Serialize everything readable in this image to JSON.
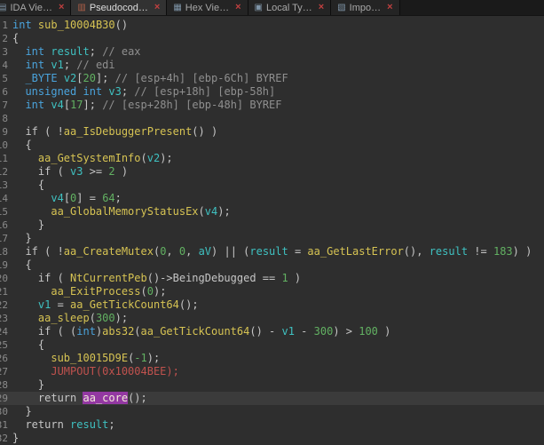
{
  "ui": {
    "close_glyph": "×"
  },
  "colors": {
    "background": "#2e2e2e",
    "type_keyword": "#4aa3dc",
    "identifier": "#3fc1c1",
    "function_name": "#d6c353",
    "number": "#62b162",
    "comment": "#8f8f8f",
    "macro": "#c0524e",
    "highlight_background": "#9338a2",
    "current_line_background": "#3b3b3b",
    "tab_close": "#c14040"
  },
  "tabs": [
    {
      "id": "ida-view",
      "label": "IDA Vie…",
      "icon": "ida-view-icon",
      "glyph": "▤",
      "active": false
    },
    {
      "id": "pseudocode",
      "label": "Pseudocod…",
      "icon": "pseudocode-icon",
      "glyph": "▥",
      "active": true
    },
    {
      "id": "hex-view",
      "label": "Hex Vie…",
      "icon": "hex-view-icon",
      "glyph": "▦",
      "active": false
    },
    {
      "id": "local-types",
      "label": "Local Ty…",
      "icon": "local-types-icon",
      "glyph": "▣",
      "active": false
    },
    {
      "id": "imports",
      "label": "Impo…",
      "icon": "imports-icon",
      "glyph": "▧",
      "active": false
    }
  ],
  "code": {
    "lines": [
      {
        "n": 1,
        "tokens": [
          {
            "c": "type",
            "t": "int"
          },
          {
            "c": "plain",
            "t": " "
          },
          {
            "c": "func",
            "t": "sub_10004B30"
          },
          {
            "c": "plain",
            "t": "()"
          }
        ]
      },
      {
        "n": 2,
        "tokens": [
          {
            "c": "plain",
            "t": "{"
          }
        ]
      },
      {
        "n": 3,
        "tokens": [
          {
            "c": "plain",
            "t": "  "
          },
          {
            "c": "type",
            "t": "int"
          },
          {
            "c": "plain",
            "t": " "
          },
          {
            "c": "var",
            "t": "result"
          },
          {
            "c": "plain",
            "t": "; "
          },
          {
            "c": "comment",
            "t": "// eax"
          }
        ]
      },
      {
        "n": 4,
        "tokens": [
          {
            "c": "plain",
            "t": "  "
          },
          {
            "c": "type",
            "t": "int"
          },
          {
            "c": "plain",
            "t": " "
          },
          {
            "c": "var",
            "t": "v1"
          },
          {
            "c": "plain",
            "t": "; "
          },
          {
            "c": "comment",
            "t": "// edi"
          }
        ]
      },
      {
        "n": 5,
        "tokens": [
          {
            "c": "plain",
            "t": "  "
          },
          {
            "c": "type",
            "t": "_BYTE"
          },
          {
            "c": "plain",
            "t": " "
          },
          {
            "c": "var",
            "t": "v2"
          },
          {
            "c": "plain",
            "t": "["
          },
          {
            "c": "num",
            "t": "20"
          },
          {
            "c": "plain",
            "t": "]; "
          },
          {
            "c": "comment",
            "t": "// [esp+4h] [ebp-6Ch] BYREF"
          }
        ]
      },
      {
        "n": 6,
        "tokens": [
          {
            "c": "plain",
            "t": "  "
          },
          {
            "c": "type",
            "t": "unsigned int"
          },
          {
            "c": "plain",
            "t": " "
          },
          {
            "c": "var",
            "t": "v3"
          },
          {
            "c": "plain",
            "t": "; "
          },
          {
            "c": "comment",
            "t": "// [esp+18h] [ebp-58h]"
          }
        ]
      },
      {
        "n": 7,
        "tokens": [
          {
            "c": "plain",
            "t": "  "
          },
          {
            "c": "type",
            "t": "int"
          },
          {
            "c": "plain",
            "t": " "
          },
          {
            "c": "var",
            "t": "v4"
          },
          {
            "c": "plain",
            "t": "["
          },
          {
            "c": "num",
            "t": "17"
          },
          {
            "c": "plain",
            "t": "]; "
          },
          {
            "c": "comment",
            "t": "// [esp+28h] [ebp-48h] BYREF"
          }
        ]
      },
      {
        "n": 8,
        "tokens": []
      },
      {
        "n": 9,
        "tokens": [
          {
            "c": "plain",
            "t": "  if ( !"
          },
          {
            "c": "func",
            "t": "aa_IsDebuggerPresent"
          },
          {
            "c": "plain",
            "t": "() )"
          }
        ]
      },
      {
        "n": 10,
        "tokens": [
          {
            "c": "plain",
            "t": "  {"
          }
        ]
      },
      {
        "n": 11,
        "tokens": [
          {
            "c": "plain",
            "t": "    "
          },
          {
            "c": "func",
            "t": "aa_GetSystemInfo"
          },
          {
            "c": "plain",
            "t": "("
          },
          {
            "c": "var",
            "t": "v2"
          },
          {
            "c": "plain",
            "t": ");"
          }
        ]
      },
      {
        "n": 12,
        "tokens": [
          {
            "c": "plain",
            "t": "    if ( "
          },
          {
            "c": "var",
            "t": "v3"
          },
          {
            "c": "plain",
            "t": " >= "
          },
          {
            "c": "num",
            "t": "2"
          },
          {
            "c": "plain",
            "t": " )"
          }
        ]
      },
      {
        "n": 13,
        "tokens": [
          {
            "c": "plain",
            "t": "    {"
          }
        ]
      },
      {
        "n": 14,
        "tokens": [
          {
            "c": "plain",
            "t": "      "
          },
          {
            "c": "var",
            "t": "v4"
          },
          {
            "c": "plain",
            "t": "["
          },
          {
            "c": "num",
            "t": "0"
          },
          {
            "c": "plain",
            "t": "] = "
          },
          {
            "c": "num",
            "t": "64"
          },
          {
            "c": "plain",
            "t": ";"
          }
        ]
      },
      {
        "n": 15,
        "tokens": [
          {
            "c": "plain",
            "t": "      "
          },
          {
            "c": "func",
            "t": "aa_GlobalMemoryStatusEx"
          },
          {
            "c": "plain",
            "t": "("
          },
          {
            "c": "var",
            "t": "v4"
          },
          {
            "c": "plain",
            "t": ");"
          }
        ]
      },
      {
        "n": 16,
        "tokens": [
          {
            "c": "plain",
            "t": "    }"
          }
        ]
      },
      {
        "n": 17,
        "tokens": [
          {
            "c": "plain",
            "t": "  }"
          }
        ]
      },
      {
        "n": 18,
        "tokens": [
          {
            "c": "plain",
            "t": "  if ( !"
          },
          {
            "c": "func",
            "t": "aa_CreateMutex"
          },
          {
            "c": "plain",
            "t": "("
          },
          {
            "c": "num",
            "t": "0"
          },
          {
            "c": "plain",
            "t": ", "
          },
          {
            "c": "num",
            "t": "0"
          },
          {
            "c": "plain",
            "t": ", "
          },
          {
            "c": "var",
            "t": "aV"
          },
          {
            "c": "plain",
            "t": ") || ("
          },
          {
            "c": "var",
            "t": "result"
          },
          {
            "c": "plain",
            "t": " = "
          },
          {
            "c": "func",
            "t": "aa_GetLastError"
          },
          {
            "c": "plain",
            "t": "(), "
          },
          {
            "c": "var",
            "t": "result"
          },
          {
            "c": "plain",
            "t": " != "
          },
          {
            "c": "num",
            "t": "183"
          },
          {
            "c": "plain",
            "t": ") )"
          }
        ]
      },
      {
        "n": 19,
        "tokens": [
          {
            "c": "plain",
            "t": "  {"
          }
        ]
      },
      {
        "n": 20,
        "tokens": [
          {
            "c": "plain",
            "t": "    if ( "
          },
          {
            "c": "func",
            "t": "NtCurrentPeb"
          },
          {
            "c": "plain",
            "t": "()->BeingDebugged == "
          },
          {
            "c": "num",
            "t": "1"
          },
          {
            "c": "plain",
            "t": " )"
          }
        ]
      },
      {
        "n": 21,
        "tokens": [
          {
            "c": "plain",
            "t": "      "
          },
          {
            "c": "func",
            "t": "aa_ExitProcess"
          },
          {
            "c": "plain",
            "t": "("
          },
          {
            "c": "num",
            "t": "0"
          },
          {
            "c": "plain",
            "t": ");"
          }
        ]
      },
      {
        "n": 22,
        "tokens": [
          {
            "c": "plain",
            "t": "    "
          },
          {
            "c": "var",
            "t": "v1"
          },
          {
            "c": "plain",
            "t": " = "
          },
          {
            "c": "func",
            "t": "aa_GetTickCount64"
          },
          {
            "c": "plain",
            "t": "();"
          }
        ]
      },
      {
        "n": 23,
        "tokens": [
          {
            "c": "plain",
            "t": "    "
          },
          {
            "c": "func",
            "t": "aa_sleep"
          },
          {
            "c": "plain",
            "t": "("
          },
          {
            "c": "num",
            "t": "300"
          },
          {
            "c": "plain",
            "t": ");"
          }
        ]
      },
      {
        "n": 24,
        "tokens": [
          {
            "c": "plain",
            "t": "    if ( ("
          },
          {
            "c": "type",
            "t": "int"
          },
          {
            "c": "plain",
            "t": ")"
          },
          {
            "c": "func",
            "t": "abs32"
          },
          {
            "c": "plain",
            "t": "("
          },
          {
            "c": "func",
            "t": "aa_GetTickCount64"
          },
          {
            "c": "plain",
            "t": "() - "
          },
          {
            "c": "var",
            "t": "v1"
          },
          {
            "c": "plain",
            "t": " - "
          },
          {
            "c": "num",
            "t": "300"
          },
          {
            "c": "plain",
            "t": ") > "
          },
          {
            "c": "num",
            "t": "100"
          },
          {
            "c": "plain",
            "t": " )"
          }
        ]
      },
      {
        "n": 25,
        "tokens": [
          {
            "c": "plain",
            "t": "    {"
          }
        ]
      },
      {
        "n": 26,
        "tokens": [
          {
            "c": "plain",
            "t": "      "
          },
          {
            "c": "func",
            "t": "sub_10015D9E"
          },
          {
            "c": "plain",
            "t": "("
          },
          {
            "c": "num",
            "t": "-1"
          },
          {
            "c": "plain",
            "t": ");"
          }
        ]
      },
      {
        "n": 27,
        "tokens": [
          {
            "c": "plain",
            "t": "      "
          },
          {
            "c": "macro",
            "t": "JUMPOUT(0x10004BEE);"
          }
        ]
      },
      {
        "n": 28,
        "tokens": [
          {
            "c": "plain",
            "t": "    }"
          }
        ]
      },
      {
        "n": 29,
        "current": true,
        "tokens": [
          {
            "c": "plain",
            "t": "    return "
          },
          {
            "c": "hl",
            "t": "aa_core"
          },
          {
            "c": "plain",
            "t": "();"
          }
        ]
      },
      {
        "n": 30,
        "tokens": [
          {
            "c": "plain",
            "t": "  }"
          }
        ]
      },
      {
        "n": 31,
        "tokens": [
          {
            "c": "plain",
            "t": "  return "
          },
          {
            "c": "var",
            "t": "result"
          },
          {
            "c": "plain",
            "t": ";"
          }
        ]
      },
      {
        "n": 32,
        "tokens": [
          {
            "c": "plain",
            "t": "}"
          }
        ]
      }
    ]
  }
}
